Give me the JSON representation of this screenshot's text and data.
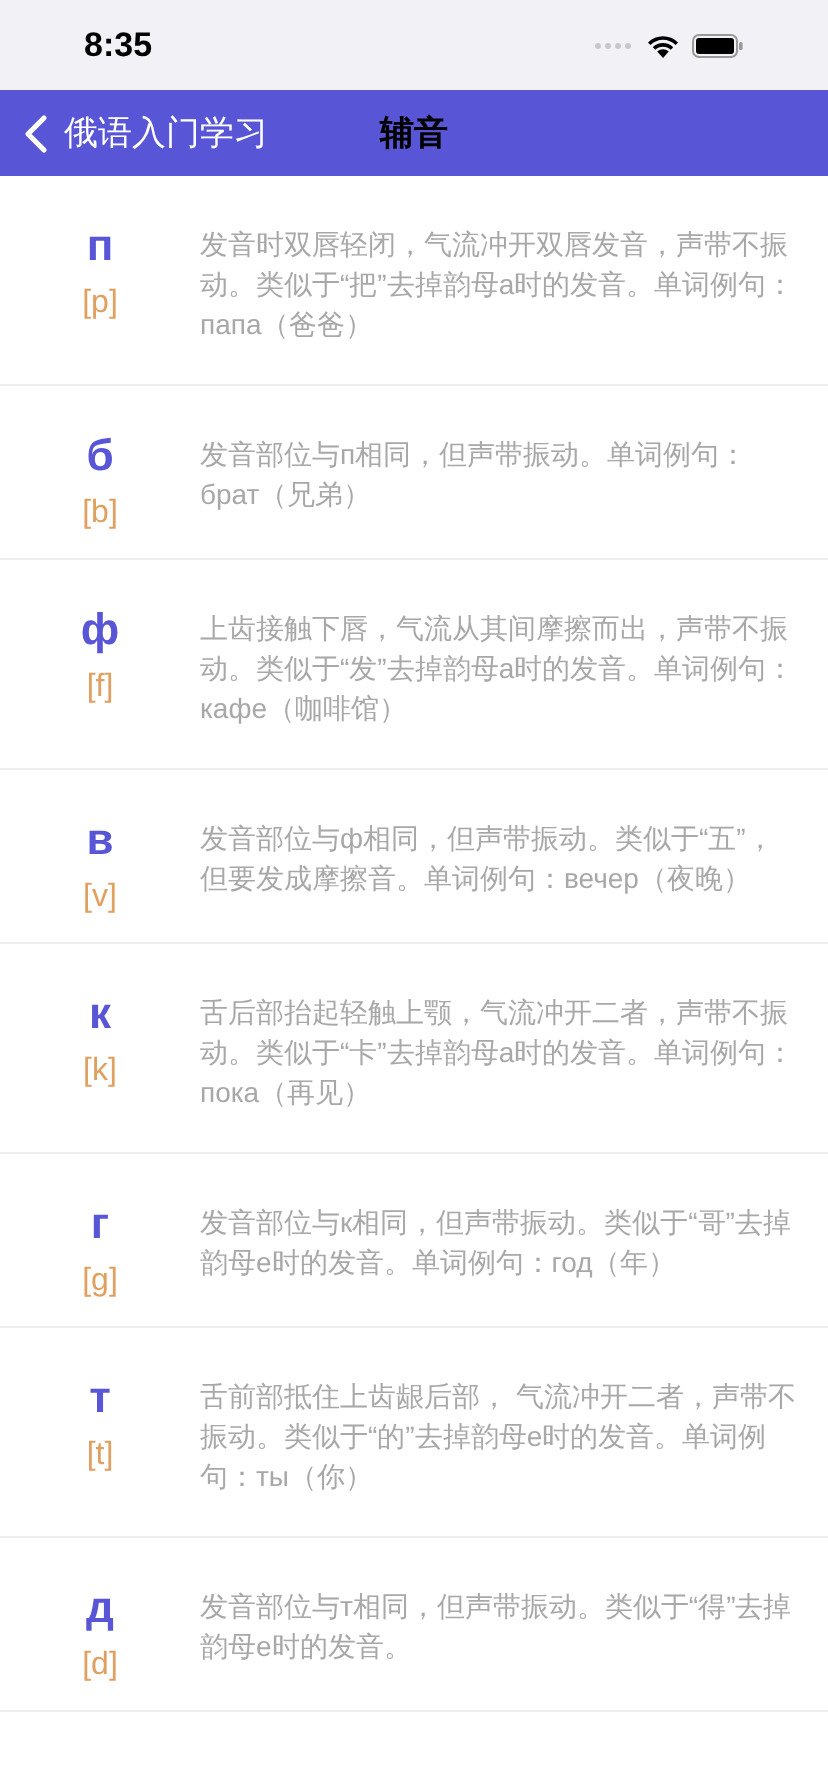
{
  "status_bar": {
    "time": "8:35"
  },
  "nav": {
    "back_label": "俄语入门学习",
    "title": "辅音"
  },
  "consonants": [
    {
      "letter": "п",
      "ipa": "[p]",
      "description": "发音时双唇轻闭，气流冲开双唇发音，声带不振动。类似于“把”去掉韵母a时的发音。单词例句：папа（爸爸）"
    },
    {
      "letter": "б",
      "ipa": "[b]",
      "description": "发音部位与п相同，但声带振动。单词例句：брат（兄弟）"
    },
    {
      "letter": "ф",
      "ipa": "[f]",
      "description": "上齿接触下唇，气流从其间摩擦而出，声带不振动。类似于“发”去掉韵母a时的发音。单词例句：кафе（咖啡馆）"
    },
    {
      "letter": "в",
      "ipa": "[v]",
      "description": "发音部位与ф相同，但声带振动。类似于“五”，但要发成摩擦音。单词例句：вечер（夜晚）"
    },
    {
      "letter": "к",
      "ipa": "[k]",
      "description": "舌后部抬起轻触上颚，气流冲开二者，声带不振动。类似于“卡”去掉韵母a时的发音。单词例句：пока（再见）"
    },
    {
      "letter": "г",
      "ipa": "[g]",
      "description": "发音部位与к相同，但声带振动。类似于“哥”去掉韵母e时的发音。单词例句：год（年）"
    },
    {
      "letter": "т",
      "ipa": "[t]",
      "description": "舌前部抵住上齿龈后部， 气流冲开二者，声带不振动。类似于“的”去掉韵母e时的发音。单词例句：ты（你）"
    },
    {
      "letter": "д",
      "ipa": "[d]",
      "description": "发音部位与т相同，但声带振动。类似于“得”去掉韵母e时的发音。"
    }
  ]
}
